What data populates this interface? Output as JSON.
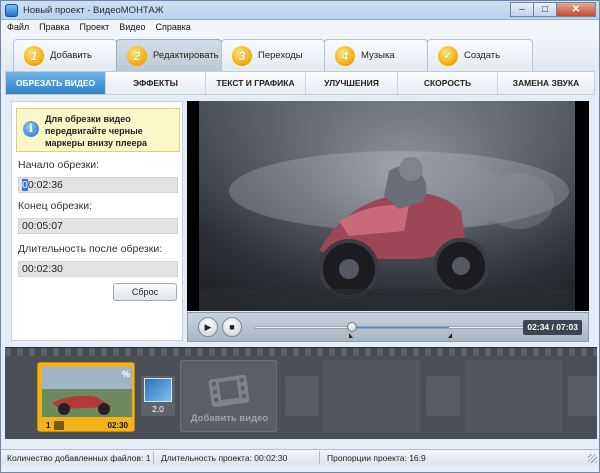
{
  "window": {
    "title": "Новый проект - ВидеоМОНТАЖ",
    "min": "–",
    "max": "□",
    "close": "✕"
  },
  "menu": [
    "Файл",
    "Правка",
    "Проект",
    "Видео",
    "Справка"
  ],
  "main_tabs": [
    {
      "num": "1",
      "label": "Добавить"
    },
    {
      "num": "2",
      "label": "Редактировать"
    },
    {
      "num": "3",
      "label": "Переходы"
    },
    {
      "num": "4",
      "label": "Музыка"
    },
    {
      "num": "✓",
      "label": "Создать"
    }
  ],
  "sub_tabs": [
    "ОБРЕЗАТЬ ВИДЕО",
    "ЭФФЕКТЫ",
    "ТЕКСТ И ГРАФИКА",
    "УЛУЧШЕНИЯ",
    "СКОРОСТЬ",
    "ЗАМЕНА ЗВУКА"
  ],
  "trim": {
    "info": "Для обрезки видео передвигайте черные маркеры внизу плеера",
    "start_label": "Начало обрезки:",
    "start_first": "0",
    "start_rest": "0:02:36",
    "end_label": "Конец обрезки:",
    "end_value": "00:05:07",
    "duration_label": "Длительность после обрезки:",
    "duration_value": "00:02:30",
    "reset": "Сброс"
  },
  "player": {
    "timecode": "02:34 / 07:03",
    "play_icon": "▶",
    "stop_icon": "■",
    "position_fraction": 0.36,
    "trim_start_fraction": 0.36,
    "trim_end_fraction": 0.72
  },
  "timeline": {
    "clip_index": "1",
    "clip_duration": "02:30",
    "clip_fx": "%",
    "transition_value": "2.0",
    "add_video": "Добавить видео"
  },
  "status": {
    "files": "Количество добавленных файлов: 1",
    "duration": "Длительность проекта: 00:02:30",
    "proportions": "Пропорции проекта: 16:9"
  }
}
